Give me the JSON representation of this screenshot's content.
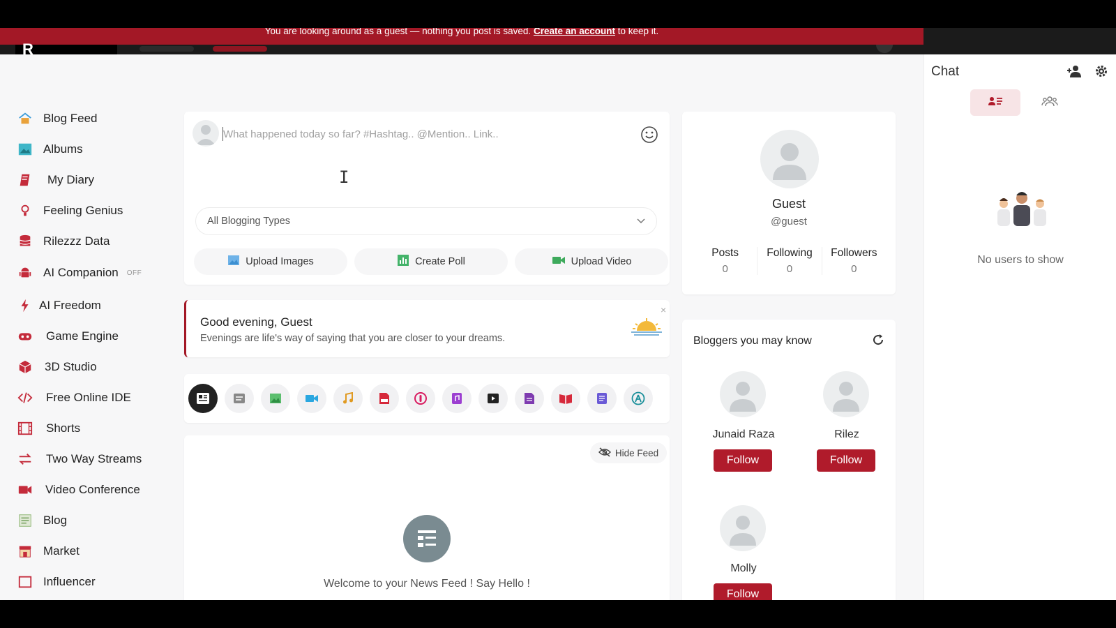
{
  "banner": {
    "text_before": "You are looking around as a guest — nothing you post is saved. ",
    "link": "Create an account",
    "text_after": " to keep it."
  },
  "sidebar": {
    "items": [
      {
        "label": "Blog Feed",
        "icon": "home-icon"
      },
      {
        "label": "Albums",
        "icon": "albums-icon"
      },
      {
        "label": "My Diary",
        "icon": "diary-icon"
      },
      {
        "label": "Feeling Genius",
        "icon": "lightbulb-icon"
      },
      {
        "label": "Rilezzz Data",
        "icon": "database-icon"
      },
      {
        "label": "AI Companion",
        "icon": "android-icon",
        "badge": "OFF"
      },
      {
        "label": "AI Freedom",
        "icon": "lightning-icon"
      },
      {
        "label": "Game Engine",
        "icon": "gamepad-icon"
      },
      {
        "label": "3D Studio",
        "icon": "cube-icon"
      },
      {
        "label": "Free Online IDE",
        "icon": "code-icon"
      },
      {
        "label": "Shorts",
        "icon": "film-icon"
      },
      {
        "label": "Two Way Streams",
        "icon": "arrows-icon"
      },
      {
        "label": "Video Conference",
        "icon": "video-camera-icon"
      },
      {
        "label": "Blog",
        "icon": "blog-icon"
      },
      {
        "label": "Market",
        "icon": "market-icon"
      },
      {
        "label": "Influencer",
        "icon": "influencer-icon"
      }
    ]
  },
  "composer": {
    "placeholder": "What happened today so far? #Hashtag.. @Mention.. Link..",
    "select_value": "All Blogging Types",
    "upload_images": "Upload Images",
    "create_poll": "Create Poll",
    "upload_video": "Upload Video"
  },
  "greeting": {
    "title": "Good evening, Guest",
    "message": "Evenings are life's way of saying that you are closer to your dreams.",
    "close": "×"
  },
  "feed": {
    "hide_label": "Hide Feed",
    "welcome": "Welcome to your News Feed ! Say Hello !"
  },
  "profile": {
    "name": "Guest",
    "handle": "@guest",
    "stats": [
      {
        "label": "Posts",
        "value": "0"
      },
      {
        "label": "Following",
        "value": "0"
      },
      {
        "label": "Followers",
        "value": "0"
      }
    ]
  },
  "bloggers": {
    "title": "Bloggers you may know",
    "follow_label": "Follow",
    "people": [
      "Junaid Raza",
      "Rilez",
      "Molly"
    ]
  },
  "chat": {
    "title": "Chat",
    "empty": "No users to show"
  },
  "colors": {
    "brand": "#a31826",
    "follow": "#b01b2b"
  }
}
